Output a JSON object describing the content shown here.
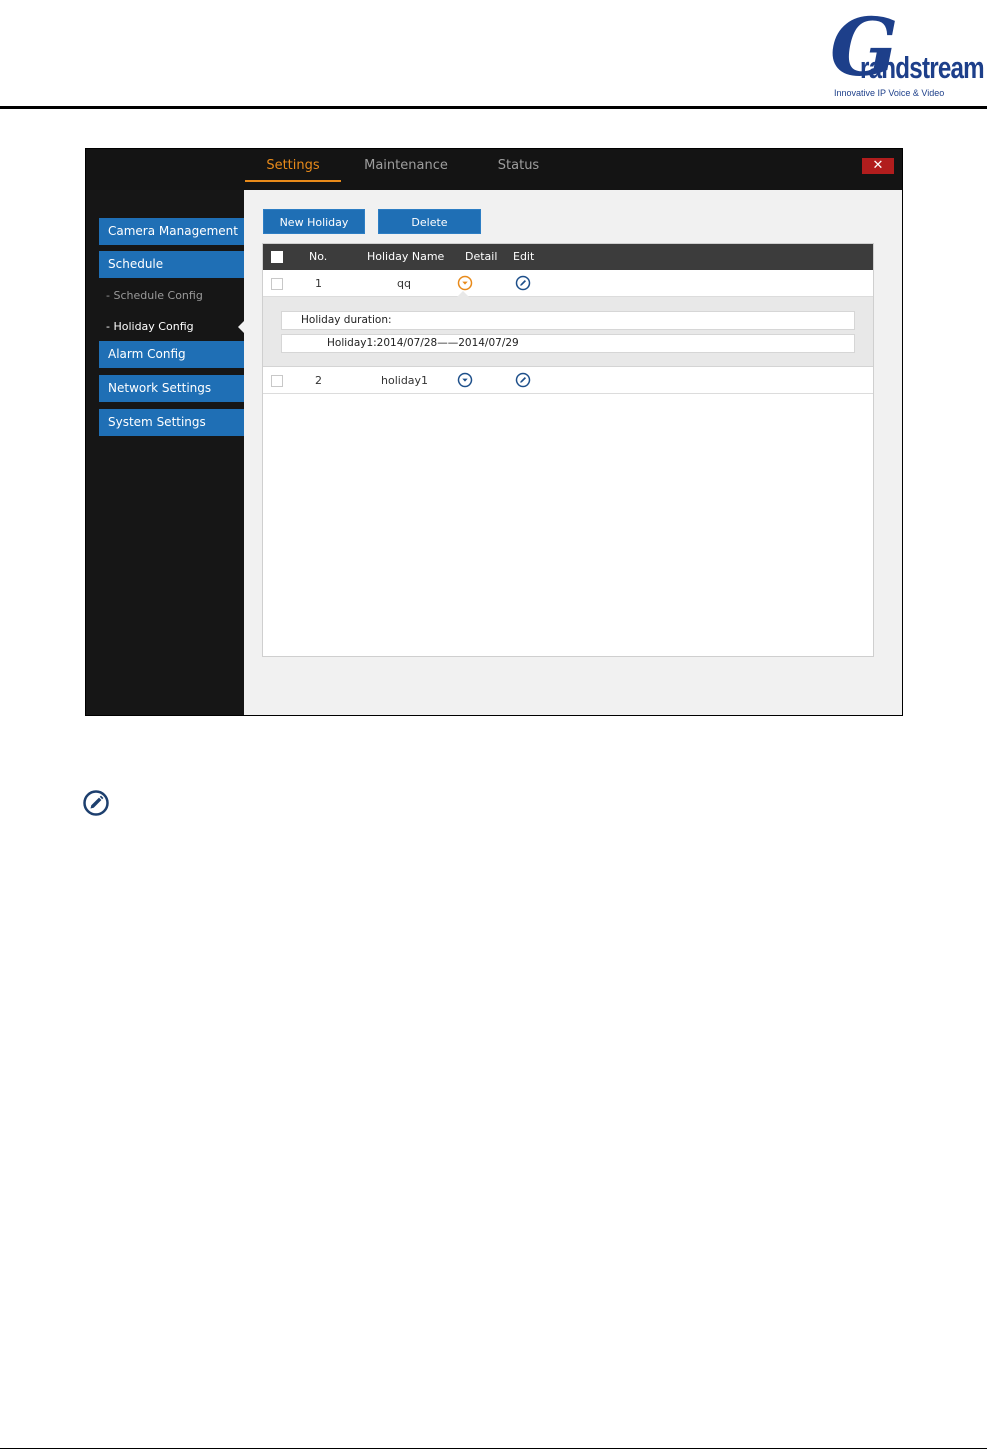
{
  "logo": {
    "mark": "G",
    "word": "randstream",
    "tagline": "Innovative IP Voice & Video"
  },
  "app": {
    "tabs": [
      {
        "label": "Settings",
        "active": true
      },
      {
        "label": "Maintenance",
        "active": false
      },
      {
        "label": "Status",
        "active": false
      }
    ],
    "close_label": "✕",
    "sidebar": {
      "items": [
        {
          "label": "Camera Management"
        },
        {
          "label": "Schedule"
        },
        {
          "label": "- Schedule Config"
        },
        {
          "label": "- Holiday Config"
        },
        {
          "label": "Alarm Config"
        },
        {
          "label": "Network Settings"
        },
        {
          "label": "System Settings"
        }
      ]
    },
    "toolbar": {
      "new_label": "New Holiday",
      "delete_label": "Delete"
    },
    "table": {
      "headers": {
        "no": "No.",
        "name": "Holiday Name",
        "detail": "Detail",
        "edit": "Edit"
      },
      "rows": [
        {
          "no": "1",
          "name": "qq"
        },
        {
          "no": "2",
          "name": "holiday1"
        }
      ],
      "detail": {
        "label": "Holiday duration:",
        "value": "Holiday1:2014/07/28——2014/07/29"
      }
    }
  },
  "colors": {
    "accent_orange": "#e88a1a",
    "nav_blue": "#1f6fb5",
    "close_red": "#b11d1d",
    "icon_blue": "#1d4f8a"
  },
  "icons": {
    "detail_expanded": "chevron-down-circle-icon",
    "detail_collapsed": "chevron-down-circle-icon",
    "edit": "pencil-circle-icon",
    "note": "pencil-circle-icon"
  }
}
